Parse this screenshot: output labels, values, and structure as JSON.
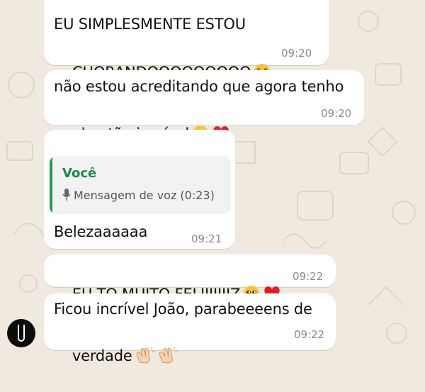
{
  "messages": [
    {
      "text_line1": "EU SIMPLESMENTE ESTOU",
      "text_line2": "CHORANDOOOOOOOOO",
      "emoji": "loudly-crying-face",
      "time": "09:20"
    },
    {
      "text_line1": "não estou acreditando que agora tenho",
      "text_line2": "algo tão incrível",
      "emoji": "pleading-face, red-heart",
      "time": "09:20"
    },
    {
      "quote": {
        "author": "Você",
        "body": "Mensagem de voz (0:23)",
        "icon": "mic-icon",
        "accent": "#1f9d55"
      },
      "text": "Belezaaaaaa",
      "time": "09:21"
    },
    {
      "text": "EU TO MUITO FELIIIIIIIZ",
      "emoji": "pleading-face, red-heart",
      "time": "09:22"
    },
    {
      "text_line1": "Ficou incrível João, parabeeeens de",
      "text_line2": "verdade",
      "emoji": "clapping-hands, clapping-hands",
      "time": "09:22"
    }
  ],
  "colors": {
    "background": "#efe9df",
    "bubble": "#ffffff",
    "accent": "#1f9d55",
    "timestamp": "#8a8a8a"
  }
}
